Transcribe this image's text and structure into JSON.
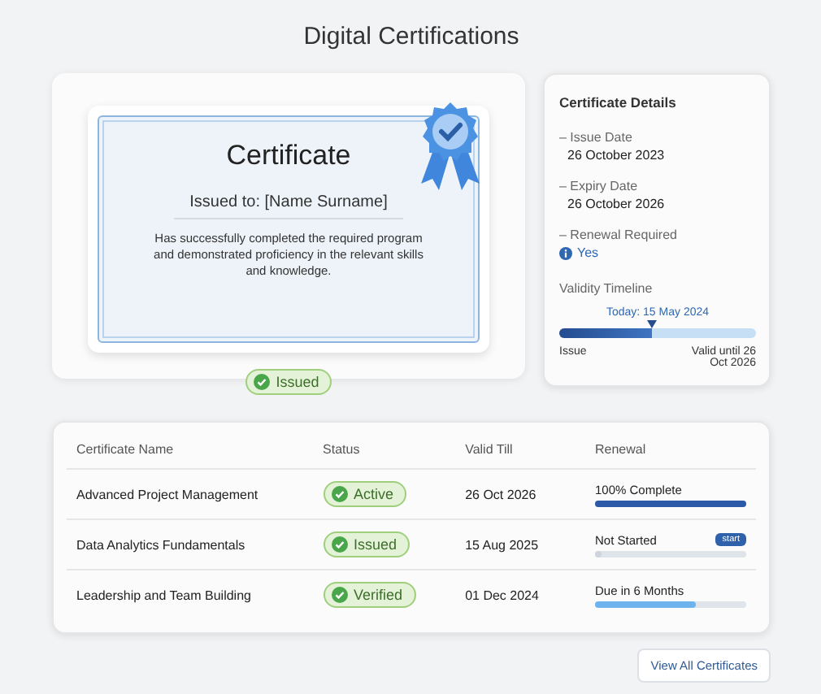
{
  "page_title": "Digital Certifications",
  "certificate": {
    "heading": "Certificate",
    "issued_to": "Issued to: [Name Surname]",
    "body": "Has successfully completed the required program and demonstrated proficiency in the relevant skills and knowledge.",
    "status": "Issued"
  },
  "details": {
    "title": "Certificate Details",
    "fields": [
      {
        "label": "– Issue Date",
        "value": "26 October 2023",
        "kind": "plain"
      },
      {
        "label": "– Expiry Date",
        "value": "26 October 2026",
        "kind": "plain"
      },
      {
        "label": "– Renewal Required",
        "value": "Yes",
        "kind": "info"
      }
    ],
    "timeline": {
      "title": "Validity Timeline",
      "today": "Today: 15 May 2024",
      "level": 0.47,
      "start_label": "Issue",
      "end_label": "Valid until 26 Oct 2026"
    }
  },
  "table": {
    "columns": [
      "Certificate Name",
      "Status",
      "Valid Till",
      "Renewal"
    ],
    "rows": [
      {
        "name": "Advanced Project Management",
        "status": "Active",
        "valid_till": "26 Oct 2026",
        "renewal": {
          "label": "100% Complete",
          "level": 1,
          "color": "#2d5aa8"
        }
      },
      {
        "name": "Data Analytics Fundamentals",
        "status": "Issued",
        "valid_till": "15 Aug 2025",
        "renewal": {
          "label": "Not Started",
          "level": 0,
          "action": "start"
        }
      },
      {
        "name": "Leadership and Team Building",
        "status": "Verified",
        "valid_till": "01 Dec 2024",
        "renewal": {
          "label": "Due in 6 Months",
          "level": 0.67,
          "color": "#6fb3ee"
        }
      }
    ]
  },
  "view_all_button": "View All Certificates"
}
